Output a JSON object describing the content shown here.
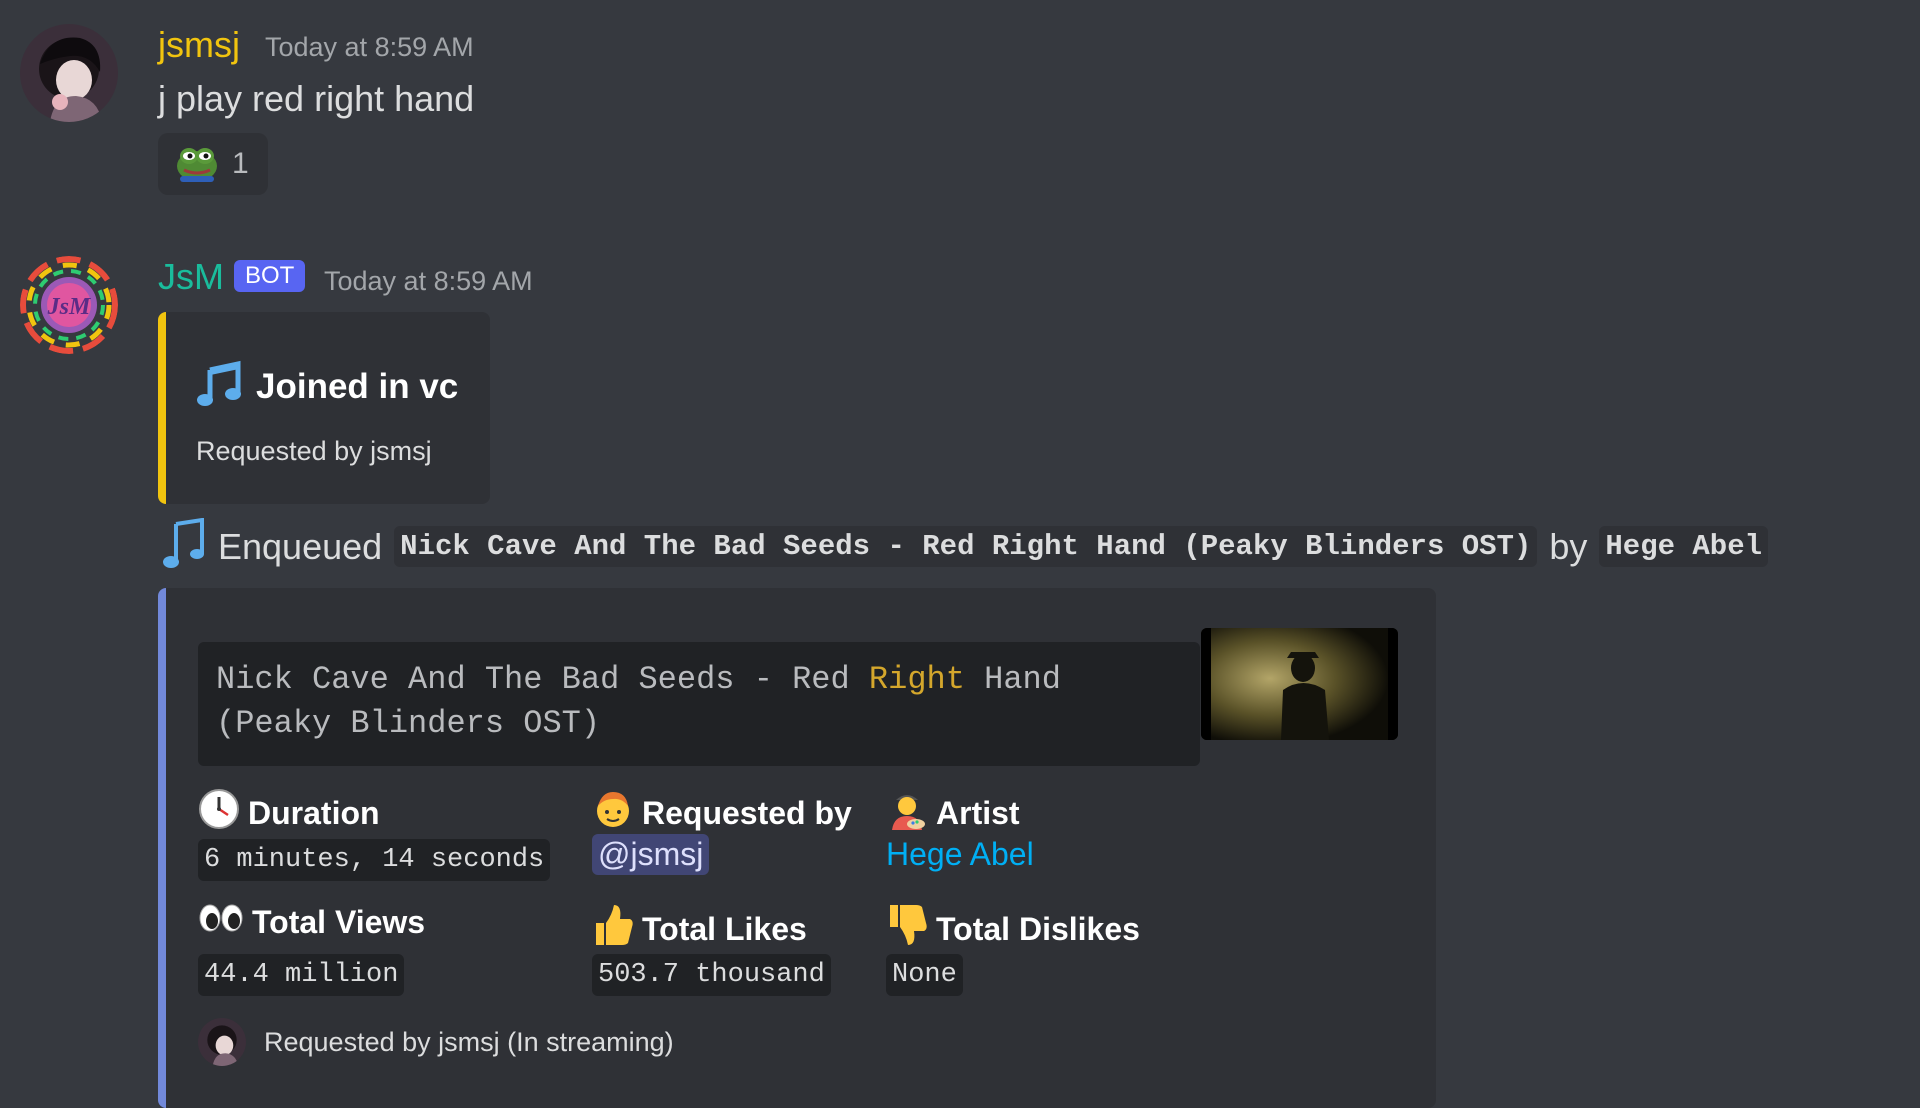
{
  "messages": [
    {
      "author": "jsmsj",
      "timestamp": "Today at 8:59 AM",
      "content": "j play red right hand",
      "reaction": {
        "emoji": "pepe-frog",
        "count": "1"
      },
      "author_color": "#f1c40f"
    },
    {
      "author": "JsM",
      "bot_tag": "BOT",
      "timestamp": "Today at 8:59 AM",
      "author_color": "#1abc9c",
      "embed1": {
        "accent_color": "#f1c40f",
        "title": "Joined in vc",
        "description": "Requested by jsmsj",
        "icon": "music-note-icon"
      },
      "enqueue": {
        "prefix": "Enqueued",
        "song": "Nick Cave And The Bad Seeds - Red Right Hand (Peaky Blinders OST)",
        "by": "by",
        "artist": "Hege Abel"
      },
      "embed2": {
        "accent_color": "#7289da",
        "code_line1_pre": "Nick Cave And The Bad Seeds - Red ",
        "code_line1_hl": "Right",
        "code_line1_post": " Hand",
        "code_line2": "(Peaky Blinders OST)",
        "fields": {
          "duration_label": "Duration",
          "duration_value": "6 minutes, 14 seconds",
          "requested_label": "Requested by",
          "requested_value": "@jsmsj",
          "artist_label": "Artist",
          "artist_value": "Hege Abel",
          "views_label": "Total Views",
          "views_value": "44.4 million",
          "likes_label": "Total Likes",
          "likes_value": "503.7 thousand",
          "dislikes_label": "Total Dislikes",
          "dislikes_value": "None"
        },
        "footer": "Requested by jsmsj (In streaming)"
      }
    }
  ]
}
